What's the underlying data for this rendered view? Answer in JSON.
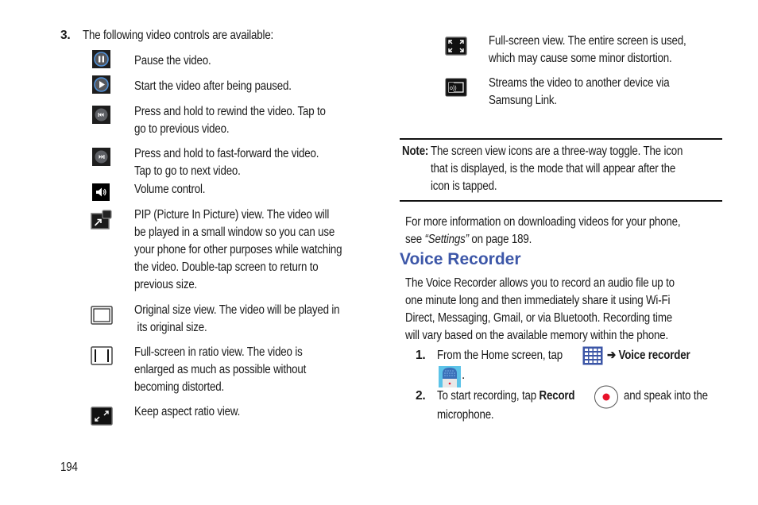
{
  "left": {
    "step_number": "3.",
    "step_text": "The following video controls are available:",
    "controls": [
      {
        "icon": "pause-icon",
        "lines": [
          "Pause the video."
        ]
      },
      {
        "icon": "play-icon",
        "lines": [
          "Start the video after being paused."
        ]
      },
      {
        "icon": "rewind-icon",
        "lines": [
          "Press and hold to rewind the video. Tap to",
          "go to previous video."
        ]
      },
      {
        "icon": "fast-forward-icon",
        "lines": [
          "Press and hold to fast-forward the video.",
          "Tap to go to next video."
        ]
      },
      {
        "icon": "volume-icon",
        "lines": [
          "Volume control."
        ]
      },
      {
        "icon": "pip-icon",
        "lines": [
          "PIP (Picture In Picture) view. The video will",
          "be played in a small window so you can use",
          "your phone for other purposes while watching",
          "the video. Double-tap screen to return to",
          "previous size."
        ]
      },
      {
        "icon": "original-size-icon",
        "lines": [
          "Original size view. The video will be played in",
          " its original size."
        ]
      },
      {
        "icon": "full-screen-ratio-icon",
        "lines": [
          "Full-screen in ratio view. The video is",
          "enlarged as much as possible without",
          "becoming distorted."
        ]
      },
      {
        "icon": "keep-aspect-ratio-icon",
        "lines": [
          "Keep aspect ratio view."
        ]
      }
    ]
  },
  "right": {
    "controls": [
      {
        "icon": "full-screen-icon",
        "lines": [
          "Full-screen view. The entire screen is used,",
          "which may cause some minor distortion."
        ]
      },
      {
        "icon": "samsung-link-icon",
        "lines": [
          "Streams the video to another device via",
          "Samsung Link."
        ]
      }
    ],
    "note": {
      "label": "Note:",
      "lines": [
        "The screen view icons are a three-way toggle. The icon",
        "that is displayed, is the mode that will appear after the",
        "icon is tapped."
      ]
    },
    "more_info": {
      "line1": "For more information on downloading videos for your phone,",
      "line2_prefix": "see ",
      "line2_link": "“Settings”",
      "line2_suffix": " on page 189."
    },
    "heading": "Voice Recorder",
    "intro_lines": [
      "The Voice Recorder allows you to record an audio file up to",
      "one minute long and then immediately share it using Wi-Fi",
      "Direct, Messaging, Gmail, or via Bluetooth. Recording time",
      "will vary based on the available memory within the phone."
    ],
    "steps": [
      {
        "number": "1.",
        "prefix": "From the Home screen, tap",
        "arrow": "➔",
        "bold": "Voice recorder",
        "end": "."
      },
      {
        "number": "2.",
        "prefix": "To start recording, tap",
        "bold": "Record",
        "suffix": "and speak into the",
        "line2": "microphone."
      }
    ]
  },
  "page_number": "194",
  "colors": {
    "heading": "#3d57a8",
    "record_dot": "#e8122a",
    "apps_icon": "#3b55a6",
    "recorder_bg": "#5cc3e8"
  }
}
